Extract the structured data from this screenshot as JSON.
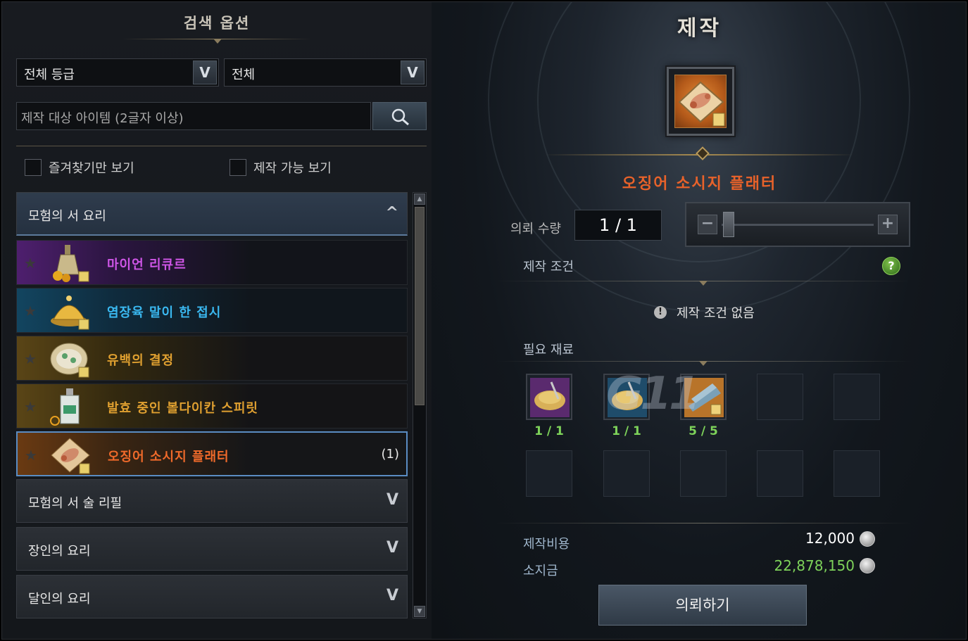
{
  "search_panel": {
    "title": "검색 옵션",
    "grade_select": "전체 등급",
    "type_select": "전체",
    "search_placeholder": "제작 대상 아이템 (2글자 이상)",
    "favorites_only": "즐겨찾기만 보기",
    "craftable_only": "제작 가능 보기"
  },
  "categories": [
    {
      "label": "모험의 서 요리",
      "expanded": true
    },
    {
      "label": "모험의 서 술 리필",
      "expanded": false
    },
    {
      "label": "장인의 요리",
      "expanded": false
    },
    {
      "label": "달인의 요리",
      "expanded": false
    }
  ],
  "recipes": [
    {
      "name": "마이언 리큐르",
      "color": "#d056e8",
      "grade": "purple"
    },
    {
      "name": "염장육 말이 한 접시",
      "color": "#3ab8f0",
      "grade": "blue"
    },
    {
      "name": "유백의 결정",
      "color": "#e0a030",
      "grade": "gold"
    },
    {
      "name": "발효 중인 볼다이칸 스피릿",
      "color": "#e0a030",
      "grade": "gold"
    },
    {
      "name": "오징어 소시지 플래터",
      "color": "#f06a2a",
      "grade": "orange",
      "count": "(1)",
      "selected": true
    }
  ],
  "craft": {
    "title": "제작",
    "item_name": "오징어 소시지 플래터",
    "item_name_color": "#e8622a",
    "quantity_label": "의뢰 수량",
    "quantity_value": "1 / 1",
    "slider_level": 0,
    "condition_label": "제작 조건",
    "no_condition": "제작 조건 없음",
    "materials_label": "필요 재료",
    "materials": [
      {
        "icon": "pasta-bowl-purple-icon",
        "qty": "1 / 1"
      },
      {
        "icon": "pasta-bowl-blue-icon",
        "qty": "1 / 1"
      },
      {
        "icon": "fish-platter-icon",
        "qty": "5 / 5"
      }
    ],
    "cost_label": "제작비용",
    "cost_value": "12,000",
    "gold_label": "소지금",
    "gold_value": "22,878,150",
    "gold_color": "#7ed35a",
    "request_button": "의뢰하기",
    "watermark": "G11"
  }
}
